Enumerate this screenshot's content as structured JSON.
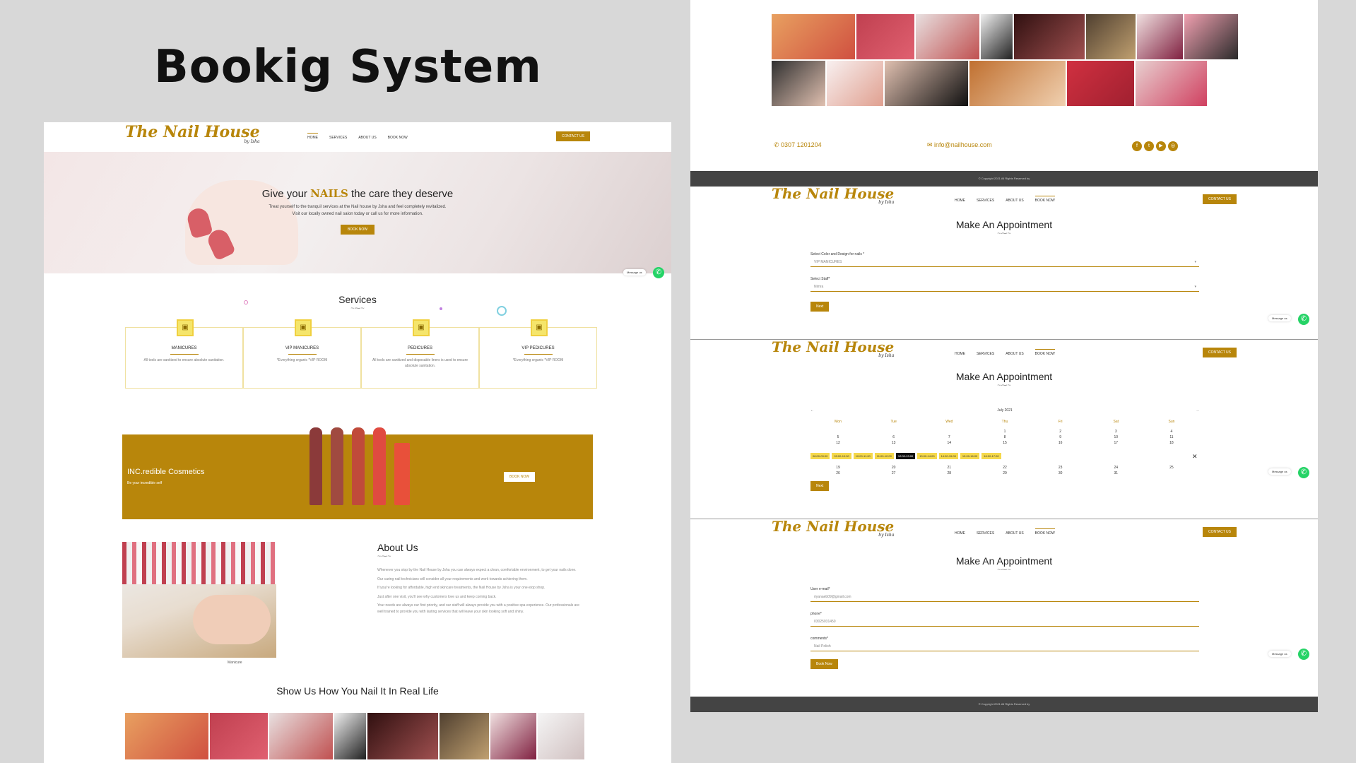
{
  "title": "Bookig System",
  "nav": {
    "logo": "The Nail House",
    "logo_sub": "by Isha",
    "links": [
      "HOME",
      "SERVICES",
      "ABOUT US",
      "BOOK NOW"
    ],
    "contact": "CONTACT US"
  },
  "hero": {
    "heading_pre": "Give your",
    "heading_highlight": "NAILS",
    "heading_post": "the care they deserve",
    "desc_line1": "Treat yourself to the tranquil services at the Nail house by Jsha and feel completely revitalized.",
    "desc_line2": "Visit our locally owned nail salon today or call us for more information.",
    "button": "BOOK NOW"
  },
  "message_us": "Message us",
  "services": {
    "title": "Services",
    "items": [
      {
        "name": "MANICURES",
        "desc": "All tools are sanitized to ensure absolute sanitation."
      },
      {
        "name": "VIP MANICURES",
        "desc": "*Everything organic *VIP ROOM"
      },
      {
        "name": "PEDICURES",
        "desc": "All tools are sanitized and disposable liners is used to ensure absolute sanitation."
      },
      {
        "name": "VIP PEDICURES",
        "desc": "*Everything organic *VIP ROOM"
      }
    ]
  },
  "banner": {
    "title": "INC.redible Cosmetics",
    "subtitle": "Be your incredible self",
    "button": "BOOK NOW"
  },
  "about": {
    "title": "About Us",
    "caption": "Manicure",
    "paragraphs": [
      "Whenever you stop by the Nail House by Jsha you can always expect a clean, comfortable environment, to get your nails done.",
      "Our caring nail technicians will consider all your requirements and work towards achieving them.",
      "If you're looking for affordable, high end skincare treatments, the Nail House by Jsha is your one-stop shop.",
      "Just after one visit, you'll see why customers love us and keep coming back.",
      "Your needs are always our first priority, and our staff will always provide you with a positive spa experience. Our professionals are well trained to provide you with lasting services that will leave your skin looking soft and shiny."
    ]
  },
  "gallery_title": "Show Us How You Nail It In Real Life",
  "contact": {
    "phone": "0307 1201204",
    "email": "info@nailhouse.com"
  },
  "footer": "© Copyright 2021 All Rights Reserved by",
  "appointment": {
    "title": "Make An Appointment",
    "color_label": "Select Color and Design for nails *",
    "color_value": "VIP MANICURES",
    "staff_label": "Select Staff*",
    "staff_value": "Nimra",
    "next": "Next",
    "month": "July 2021",
    "days": [
      "Mon",
      "Tue",
      "Wed",
      "Thu",
      "Fri",
      "Sat",
      "Sun"
    ],
    "weeks": [
      [
        "",
        "",
        "",
        "1",
        "2",
        "3",
        "4"
      ],
      [
        "5",
        "6",
        "7",
        "8",
        "9",
        "10",
        "11"
      ],
      [
        "12",
        "13",
        "14",
        "15",
        "16",
        "17",
        "18"
      ],
      [
        "19",
        "20",
        "21",
        "22",
        "23",
        "24",
        "25"
      ],
      [
        "26",
        "27",
        "28",
        "29",
        "30",
        "31",
        ""
      ]
    ],
    "slots": [
      "08:00-09:00",
      "09:00-10:00",
      "10:00-11:00",
      "11:00-12:00",
      "12:00-13:00",
      "13:00-14:00",
      "14:00-15:00",
      "15:00-16:00",
      "16:00-17:00"
    ],
    "email_label": "User e-mail*",
    "email_value": "riyanaeb09@gmail.com",
    "phone_label": "phone*",
    "phone_value": "03025031450",
    "comments_label": "comments*",
    "comments_value": "Nail Polish",
    "book": "Book Now"
  },
  "colors": {
    "accent": "#b8860b",
    "whatsapp": "#25d366",
    "footer": "#444444",
    "slot": "#f5d84a"
  }
}
